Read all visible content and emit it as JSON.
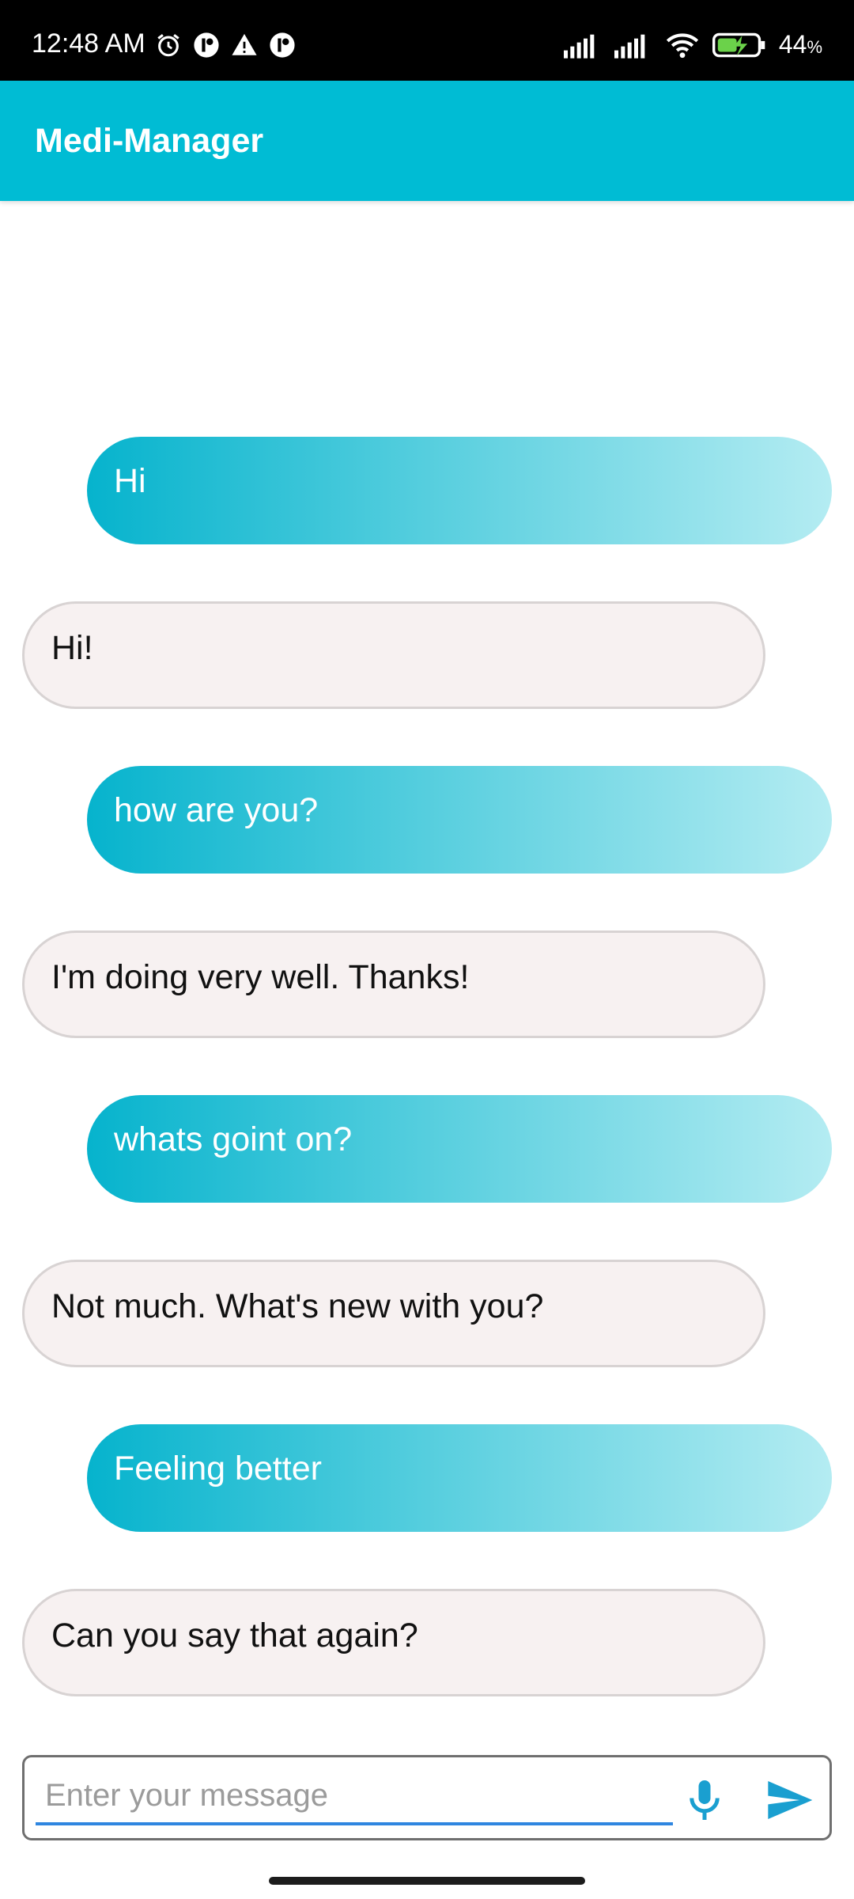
{
  "status_bar": {
    "time": "12:48 AM",
    "battery": "44",
    "battery_unit": "%",
    "icons": [
      "alarm-icon",
      "app-notification-icon",
      "warning-icon",
      "app-notification-icon",
      "signal-icon",
      "signal-icon",
      "wifi-icon",
      "battery-charging-icon"
    ]
  },
  "app_bar": {
    "title": "Medi-Manager"
  },
  "messages": [
    {
      "sender": "user",
      "text": "Hi"
    },
    {
      "sender": "bot",
      "text": "Hi!"
    },
    {
      "sender": "user",
      "text": "how are you?"
    },
    {
      "sender": "bot",
      "text": "I'm doing very well. Thanks!"
    },
    {
      "sender": "user",
      "text": "whats goint on?"
    },
    {
      "sender": "bot",
      "text": "Not much. What's new with you?"
    },
    {
      "sender": "user",
      "text": "Feeling better"
    },
    {
      "sender": "bot",
      "text": "Can you say that again?"
    }
  ],
  "composer": {
    "placeholder": "Enter your message",
    "value": "",
    "mic_icon": "mic-icon",
    "send_icon": "send-icon"
  },
  "colors": {
    "accent": "#00bcd4",
    "user_bubble_start": "#06b3cd",
    "user_bubble_end": "#b4ecf2",
    "bot_bubble": "#f7f1f1",
    "input_underline": "#2f86e0"
  }
}
